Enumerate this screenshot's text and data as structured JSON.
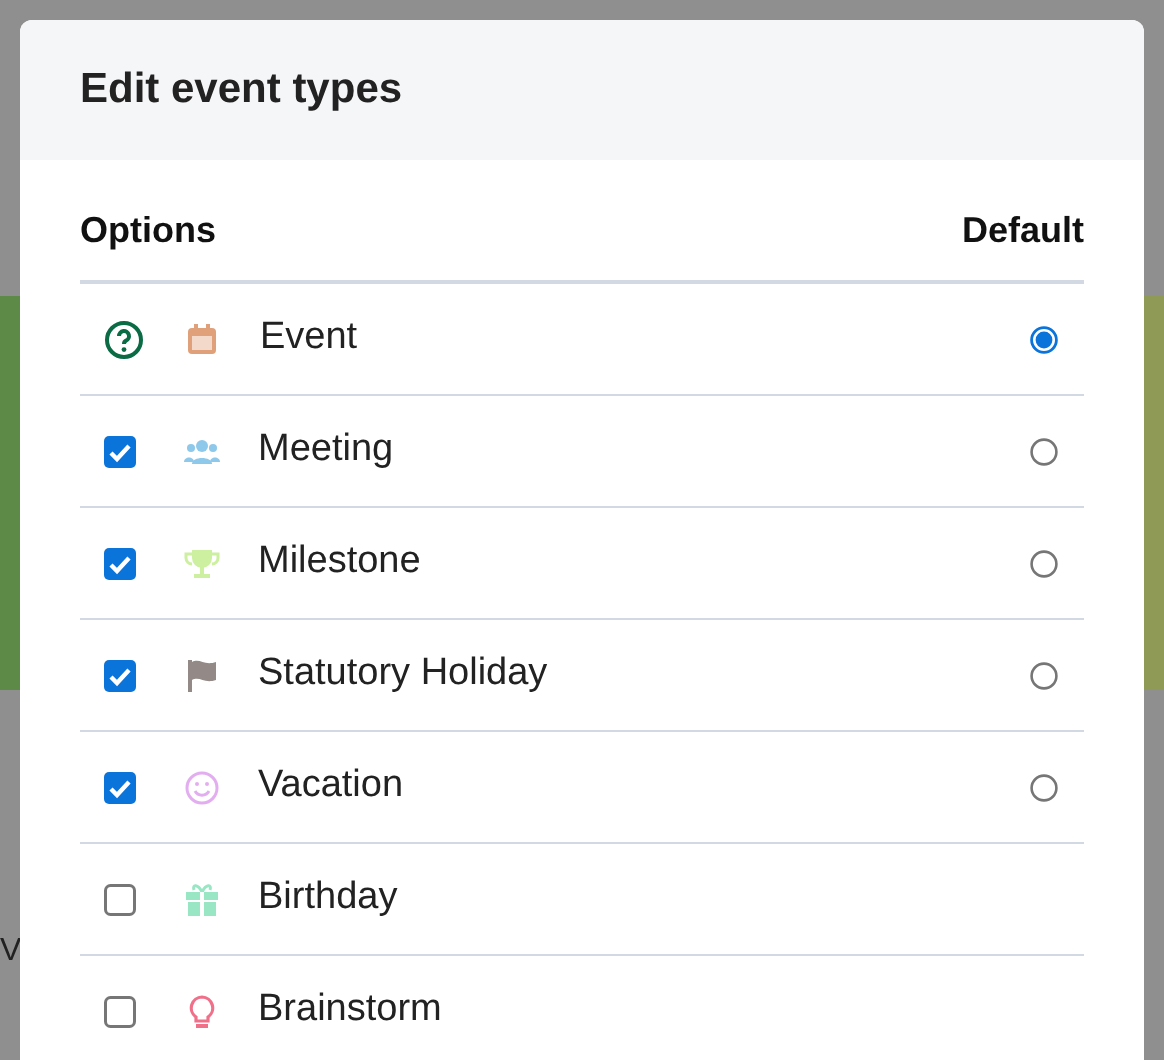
{
  "background": {
    "edge_text": "V"
  },
  "dialog": {
    "title": "Edit event types",
    "columns": [
      "Options",
      "Default"
    ],
    "rows": [
      {
        "kind": "help",
        "label": "Event",
        "color": "#e0a07a",
        "default": {
          "selected": true
        }
      },
      {
        "kind": "checkbox",
        "checked": true,
        "label": "Meeting",
        "color": "#8ec8ea",
        "default": {
          "selected": false
        }
      },
      {
        "kind": "checkbox",
        "checked": true,
        "label": "Milestone",
        "color": "#cdf0a0",
        "default": {
          "selected": false
        }
      },
      {
        "kind": "checkbox",
        "checked": true,
        "label": "Statutory Holiday",
        "color": "#938a87",
        "default": {
          "selected": false
        }
      },
      {
        "kind": "checkbox",
        "checked": true,
        "label": "Vacation",
        "color": "#e3aef0",
        "default": {
          "selected": false
        }
      },
      {
        "kind": "checkbox",
        "checked": false,
        "label": "Birthday",
        "color": "#98e6c4"
      },
      {
        "kind": "checkbox",
        "checked": false,
        "label": "Brainstorm",
        "color": "#f0708a"
      }
    ]
  }
}
